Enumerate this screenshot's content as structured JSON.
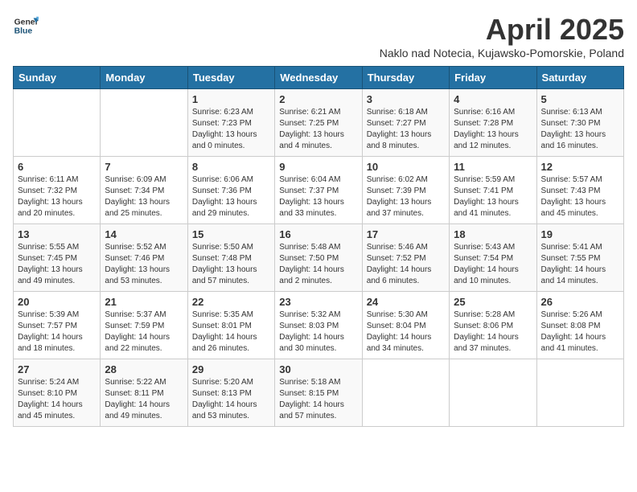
{
  "header": {
    "logo_general": "General",
    "logo_blue": "Blue",
    "month_title": "April 2025",
    "location": "Naklo nad Notecia, Kujawsko-Pomorskie, Poland"
  },
  "weekdays": [
    "Sunday",
    "Monday",
    "Tuesday",
    "Wednesday",
    "Thursday",
    "Friday",
    "Saturday"
  ],
  "weeks": [
    [
      {
        "day": "",
        "info": ""
      },
      {
        "day": "",
        "info": ""
      },
      {
        "day": "1",
        "info": "Sunrise: 6:23 AM\nSunset: 7:23 PM\nDaylight: 13 hours\nand 0 minutes."
      },
      {
        "day": "2",
        "info": "Sunrise: 6:21 AM\nSunset: 7:25 PM\nDaylight: 13 hours\nand 4 minutes."
      },
      {
        "day": "3",
        "info": "Sunrise: 6:18 AM\nSunset: 7:27 PM\nDaylight: 13 hours\nand 8 minutes."
      },
      {
        "day": "4",
        "info": "Sunrise: 6:16 AM\nSunset: 7:28 PM\nDaylight: 13 hours\nand 12 minutes."
      },
      {
        "day": "5",
        "info": "Sunrise: 6:13 AM\nSunset: 7:30 PM\nDaylight: 13 hours\nand 16 minutes."
      }
    ],
    [
      {
        "day": "6",
        "info": "Sunrise: 6:11 AM\nSunset: 7:32 PM\nDaylight: 13 hours\nand 20 minutes."
      },
      {
        "day": "7",
        "info": "Sunrise: 6:09 AM\nSunset: 7:34 PM\nDaylight: 13 hours\nand 25 minutes."
      },
      {
        "day": "8",
        "info": "Sunrise: 6:06 AM\nSunset: 7:36 PM\nDaylight: 13 hours\nand 29 minutes."
      },
      {
        "day": "9",
        "info": "Sunrise: 6:04 AM\nSunset: 7:37 PM\nDaylight: 13 hours\nand 33 minutes."
      },
      {
        "day": "10",
        "info": "Sunrise: 6:02 AM\nSunset: 7:39 PM\nDaylight: 13 hours\nand 37 minutes."
      },
      {
        "day": "11",
        "info": "Sunrise: 5:59 AM\nSunset: 7:41 PM\nDaylight: 13 hours\nand 41 minutes."
      },
      {
        "day": "12",
        "info": "Sunrise: 5:57 AM\nSunset: 7:43 PM\nDaylight: 13 hours\nand 45 minutes."
      }
    ],
    [
      {
        "day": "13",
        "info": "Sunrise: 5:55 AM\nSunset: 7:45 PM\nDaylight: 13 hours\nand 49 minutes."
      },
      {
        "day": "14",
        "info": "Sunrise: 5:52 AM\nSunset: 7:46 PM\nDaylight: 13 hours\nand 53 minutes."
      },
      {
        "day": "15",
        "info": "Sunrise: 5:50 AM\nSunset: 7:48 PM\nDaylight: 13 hours\nand 57 minutes."
      },
      {
        "day": "16",
        "info": "Sunrise: 5:48 AM\nSunset: 7:50 PM\nDaylight: 14 hours\nand 2 minutes."
      },
      {
        "day": "17",
        "info": "Sunrise: 5:46 AM\nSunset: 7:52 PM\nDaylight: 14 hours\nand 6 minutes."
      },
      {
        "day": "18",
        "info": "Sunrise: 5:43 AM\nSunset: 7:54 PM\nDaylight: 14 hours\nand 10 minutes."
      },
      {
        "day": "19",
        "info": "Sunrise: 5:41 AM\nSunset: 7:55 PM\nDaylight: 14 hours\nand 14 minutes."
      }
    ],
    [
      {
        "day": "20",
        "info": "Sunrise: 5:39 AM\nSunset: 7:57 PM\nDaylight: 14 hours\nand 18 minutes."
      },
      {
        "day": "21",
        "info": "Sunrise: 5:37 AM\nSunset: 7:59 PM\nDaylight: 14 hours\nand 22 minutes."
      },
      {
        "day": "22",
        "info": "Sunrise: 5:35 AM\nSunset: 8:01 PM\nDaylight: 14 hours\nand 26 minutes."
      },
      {
        "day": "23",
        "info": "Sunrise: 5:32 AM\nSunset: 8:03 PM\nDaylight: 14 hours\nand 30 minutes."
      },
      {
        "day": "24",
        "info": "Sunrise: 5:30 AM\nSunset: 8:04 PM\nDaylight: 14 hours\nand 34 minutes."
      },
      {
        "day": "25",
        "info": "Sunrise: 5:28 AM\nSunset: 8:06 PM\nDaylight: 14 hours\nand 37 minutes."
      },
      {
        "day": "26",
        "info": "Sunrise: 5:26 AM\nSunset: 8:08 PM\nDaylight: 14 hours\nand 41 minutes."
      }
    ],
    [
      {
        "day": "27",
        "info": "Sunrise: 5:24 AM\nSunset: 8:10 PM\nDaylight: 14 hours\nand 45 minutes."
      },
      {
        "day": "28",
        "info": "Sunrise: 5:22 AM\nSunset: 8:11 PM\nDaylight: 14 hours\nand 49 minutes."
      },
      {
        "day": "29",
        "info": "Sunrise: 5:20 AM\nSunset: 8:13 PM\nDaylight: 14 hours\nand 53 minutes."
      },
      {
        "day": "30",
        "info": "Sunrise: 5:18 AM\nSunset: 8:15 PM\nDaylight: 14 hours\nand 57 minutes."
      },
      {
        "day": "",
        "info": ""
      },
      {
        "day": "",
        "info": ""
      },
      {
        "day": "",
        "info": ""
      }
    ]
  ]
}
